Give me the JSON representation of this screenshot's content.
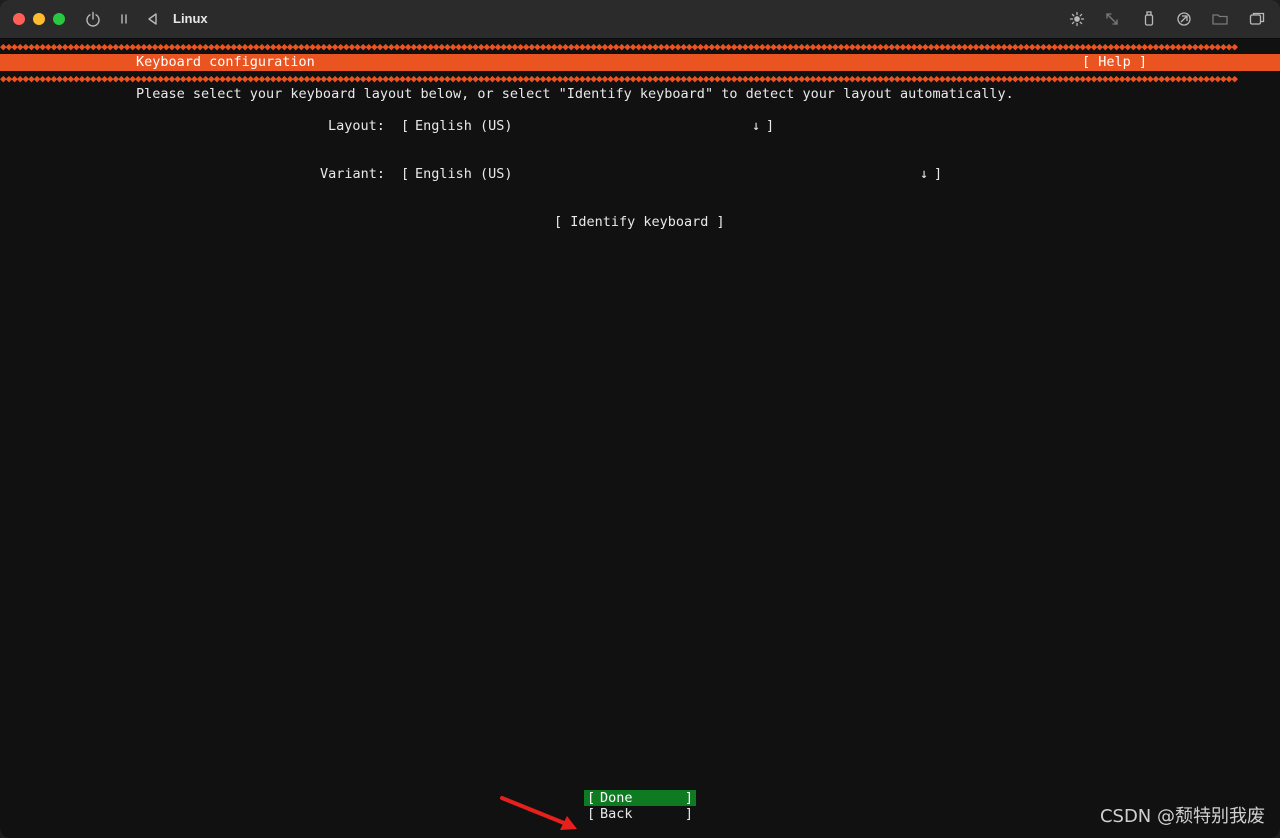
{
  "window": {
    "title": "Linux"
  },
  "toolbar_icons": [
    "power-icon",
    "pause-icon",
    "back-icon",
    "brightness-icon",
    "resize-icon",
    "usb-icon",
    "network-icon",
    "folder-icon",
    "window-icon"
  ],
  "header": {
    "title": "Keyboard configuration",
    "help": "[ Help ]",
    "accent": "#e95420"
  },
  "instructions": "Please select your keyboard layout below, or select \"Identify keyboard\" to detect your layout automatically.",
  "layout_field": {
    "label": "Layout:",
    "value": "English (US)",
    "arrow": "↓"
  },
  "variant_field": {
    "label": "Variant:",
    "value": "English (US)",
    "arrow": "↓"
  },
  "identify_button": "[ Identify keyboard ]",
  "buttons": {
    "done": "Done",
    "back": "Back",
    "bracket_left": "[",
    "bracket_right": "]",
    "done_color": "#0e7a21"
  },
  "watermark": "CSDN @颓特别我废"
}
